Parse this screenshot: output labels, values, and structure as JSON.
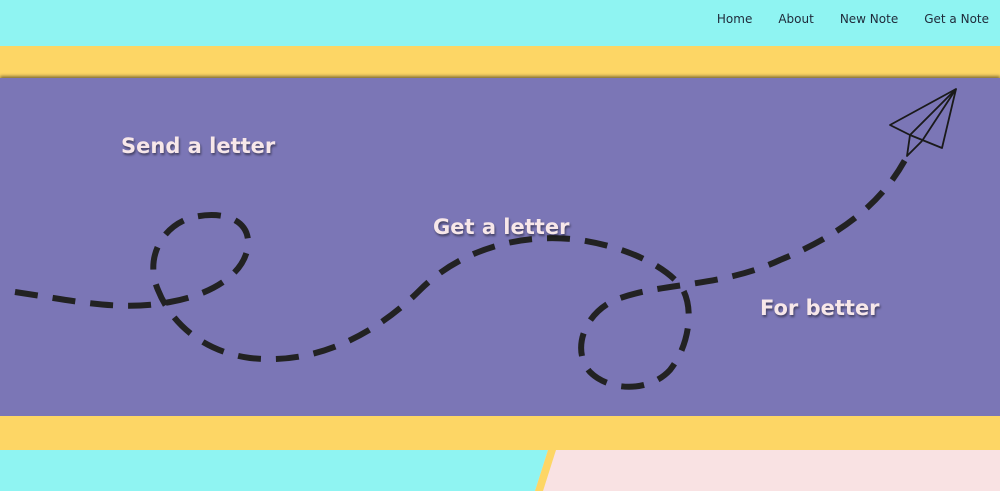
{
  "nav": {
    "links": [
      "Home",
      "About",
      "New Note",
      "Get a Note"
    ]
  },
  "hero": {
    "headline_1": "Send a letter",
    "headline_2": "Get a letter",
    "headline_3": "For better"
  },
  "colors": {
    "nav_bg": "#8ff4f2",
    "band": "#fdd665",
    "hero_bg": "#7b76b6",
    "text": "#f7e7e9",
    "footer_pink": "#f9e2e3",
    "dash": "#222222"
  },
  "icons": {
    "plane": "paper-plane-icon"
  }
}
